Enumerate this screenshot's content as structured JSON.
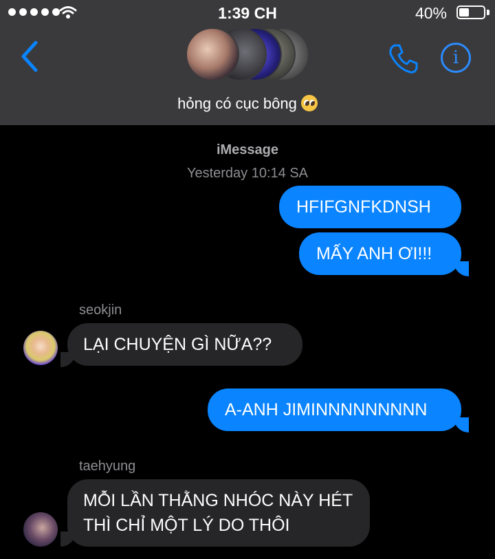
{
  "status_bar": {
    "time": "1:39 CH",
    "battery": "40%",
    "battery_level": 0.4
  },
  "header": {
    "group_name": "hỏng có cục bông",
    "group_emoji": "pleading-face-emoji",
    "info_glyph": "i",
    "icons": [
      "back-chevron-icon",
      "phone-icon",
      "info-icon",
      "wifi-icon"
    ]
  },
  "thread": {
    "service": "iMessage",
    "timestamp": "Yesterday 10:14 SA",
    "messages": [
      {
        "direction": "outgoing",
        "text": "HFIFGNFKDNSH"
      },
      {
        "direction": "outgoing",
        "text": "MẤY ANH ƠI!!!"
      },
      {
        "direction": "incoming",
        "sender": "seokjin",
        "text": "LẠI CHUYỆN GÌ NỮA??"
      },
      {
        "direction": "outgoing",
        "text": "A-ANH JIMINNNNNNNNN"
      },
      {
        "direction": "incoming",
        "sender": "taehyung",
        "text": "MỖI LẦN THẰNG NHÓC NÀY HÉT THÌ CHỈ MỘT LÝ DO THÔI"
      }
    ]
  },
  "colors": {
    "accent": "#0a84ff",
    "header_bg": "#3a3a3c",
    "incoming_bubble": "#262628"
  }
}
